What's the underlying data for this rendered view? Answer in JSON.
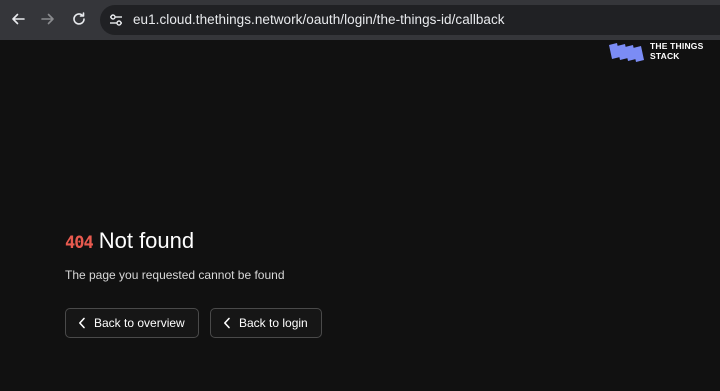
{
  "browser": {
    "url": "eu1.cloud.thethings.network/oauth/login/the-things-id/callback",
    "icons": [
      "back-arrow-icon",
      "forward-arrow-icon",
      "reload-icon",
      "site-settings-icon"
    ]
  },
  "logo": {
    "line1": "THE THINGS",
    "line2": "STACK",
    "color": "#7b8cf5"
  },
  "error": {
    "code": "404",
    "title": "Not found",
    "message": "The page you requested cannot be found",
    "code_color": "#e85a4f"
  },
  "actions": {
    "overview_label": "Back to overview",
    "login_label": "Back to login"
  }
}
